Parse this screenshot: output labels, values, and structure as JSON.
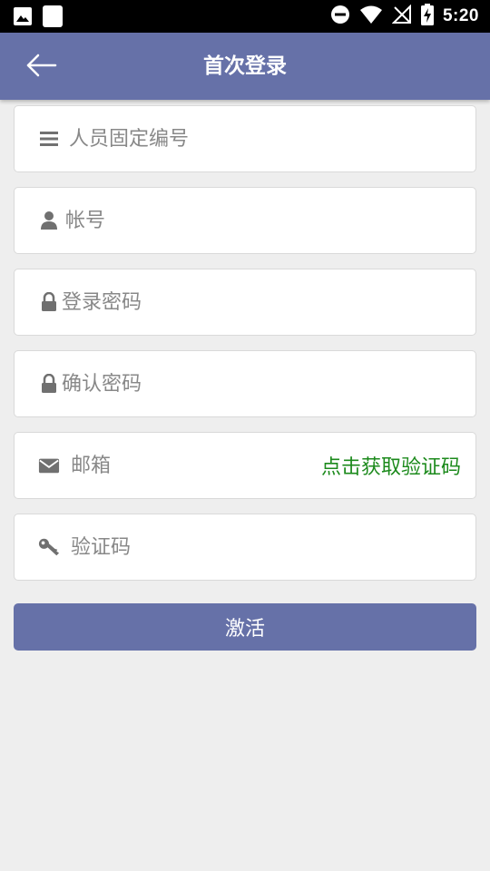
{
  "status_bar": {
    "time": "5:20",
    "left_icons": [
      "image-icon",
      "square-icon"
    ],
    "right_icons": [
      "do-not-disturb-icon",
      "wifi-icon",
      "no-sim-icon",
      "battery-charging-icon"
    ]
  },
  "app_bar": {
    "title": "首次登录",
    "back_icon": "back-arrow-icon"
  },
  "form": {
    "fields": [
      {
        "name": "staff-id",
        "icon": "list-icon",
        "placeholder": "人员固定编号",
        "value": ""
      },
      {
        "name": "account",
        "icon": "user-icon",
        "placeholder": "帐号",
        "value": ""
      },
      {
        "name": "login-password",
        "icon": "lock-icon",
        "placeholder": "登录密码",
        "value": ""
      },
      {
        "name": "confirm-password",
        "icon": "lock-icon",
        "placeholder": "确认密码",
        "value": ""
      },
      {
        "name": "email",
        "icon": "mail-icon",
        "placeholder": "邮箱",
        "value": ""
      },
      {
        "name": "verification-code",
        "icon": "key-icon",
        "placeholder": "验证码",
        "value": ""
      }
    ],
    "get_code_label": "点击获取验证码"
  },
  "activate_button": {
    "label": "激活"
  },
  "colors": {
    "primary": "#6671a8",
    "background": "#eeeeee",
    "link_green": "#1c8a1c",
    "icon_gray": "#707070"
  }
}
